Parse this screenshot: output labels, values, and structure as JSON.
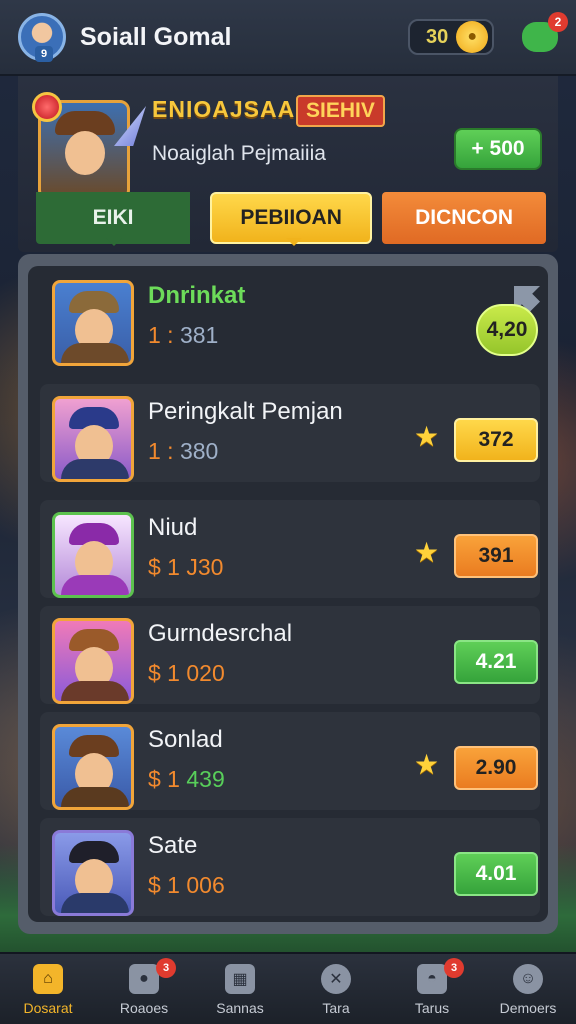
{
  "header": {
    "title": "Soiall Gomal",
    "avatar_badge": "9",
    "coins": "30",
    "chat_notifications": "2"
  },
  "event": {
    "title": "ENIOAJSAA",
    "tag": "SIEHIV",
    "subtitle": "Noaiglah Pejmaiiia",
    "reward_button": "+ 500",
    "tabs": [
      {
        "label": "EIKI"
      },
      {
        "label": "PEBIIOAN"
      },
      {
        "label": "DICNCON"
      }
    ]
  },
  "leaderboard": {
    "rows": [
      {
        "name": "Dnrinkat",
        "score_prefix": "1 :",
        "score_value": "381",
        "badge": "4,20",
        "badge_style": "pill",
        "star": false
      },
      {
        "name": "Peringkalt Pemjan",
        "score_prefix": "1 :",
        "score_value": "380",
        "badge": "372",
        "badge_style": "yellow",
        "star": true
      },
      {
        "name": "Niud",
        "score_prefix": "$ 1",
        "score_value": "J30",
        "badge": "391",
        "badge_style": "orange",
        "star": true
      },
      {
        "name": "Gurndesrchal",
        "score_prefix": "$ 1",
        "score_value": "020",
        "badge": "4.21",
        "badge_style": "green",
        "star": false
      },
      {
        "name": "Sonlad",
        "score_prefix": "$ 1",
        "score_value": "439",
        "badge": "2.90",
        "badge_style": "orange",
        "star": true
      },
      {
        "name": "Sate",
        "score_prefix": "$ 1",
        "score_value": "006",
        "badge": "4.01",
        "badge_style": "green",
        "star": false
      }
    ]
  },
  "bottom_nav": {
    "items": [
      {
        "label": "Dosarat",
        "icon": "home-icon",
        "badge": ""
      },
      {
        "label": "Roaoes",
        "icon": "pet-icon",
        "badge": "3"
      },
      {
        "label": "Sannas",
        "icon": "shop-icon",
        "badge": ""
      },
      {
        "label": "Tara",
        "icon": "battle-icon",
        "badge": ""
      },
      {
        "label": "Tarus",
        "icon": "friends-icon",
        "badge": "3"
      },
      {
        "label": "Demoers",
        "icon": "profile-icon",
        "badge": ""
      }
    ]
  },
  "colors": {
    "accent_yellow": "#f1b31c",
    "accent_orange": "#e06a24",
    "accent_green": "#35a33b",
    "notification_red": "#e03b2f"
  }
}
